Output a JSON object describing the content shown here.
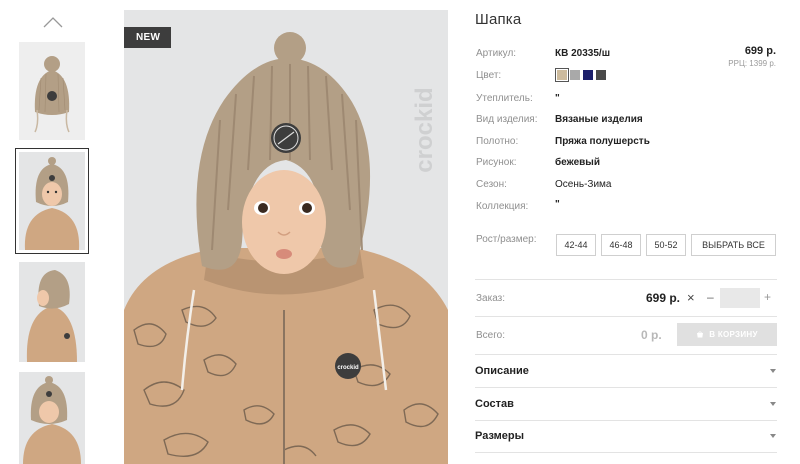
{
  "badge": "NEW",
  "product": {
    "title": "Шапка",
    "price": "699 р.",
    "rrp": "РРЦ: 1399 р."
  },
  "attributes": [
    {
      "label": "Артикул:",
      "value": "КВ 20335/ш",
      "bold": true
    },
    {
      "label": "Цвет:",
      "value": ""
    },
    {
      "label": "Утеплитель:",
      "value": "\"",
      "bold": true
    },
    {
      "label": "Вид изделия:",
      "value": "Вязаные изделия",
      "bold": true
    },
    {
      "label": "Полотно:",
      "value": "Пряжа полушерсть",
      "bold": true
    },
    {
      "label": "Рисунок:",
      "value": "бежевый",
      "bold": true
    },
    {
      "label": "Сезон:",
      "value": "Осень-Зима",
      "bold": false
    },
    {
      "label": "Коллекция:",
      "value": "\"",
      "bold": true
    }
  ],
  "colors": [
    {
      "hex": "#cdbb9d",
      "selected": true
    },
    {
      "hex": "#a9a9a9",
      "selected": false
    },
    {
      "hex": "#1c1f6b",
      "selected": false
    },
    {
      "hex": "#4a4a4a",
      "selected": false
    }
  ],
  "size": {
    "label": "Рост/размер:",
    "options": [
      "42-44",
      "46-48",
      "50-52"
    ],
    "select_all": "ВЫБРАТЬ ВСЕ"
  },
  "order": {
    "label": "Заказ:",
    "price": "699 р.",
    "times": "×",
    "minus": "–",
    "plus": "+",
    "quantity": ""
  },
  "total": {
    "label": "Всего:",
    "value": "0 р.",
    "cart_button": "В КОРЗИНУ"
  },
  "accordion": [
    "Описание",
    "Состав",
    "Размеры"
  ],
  "brand_watermark": "crockid",
  "colors_theme": {
    "hat": "#b39f86",
    "hat_dark": "#9c8770",
    "jacket": "#cfa782",
    "skin": "#efc8aa",
    "badge_bg": "#3d3d3d"
  }
}
